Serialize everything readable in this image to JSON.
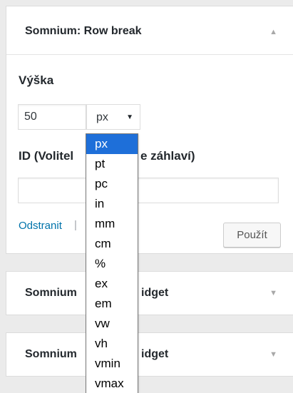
{
  "main_widget": {
    "title": "Somnium: Row break",
    "height_label": "Výška",
    "height_value": "50",
    "unit_selected": "px",
    "id_label_left": "ID (Volitel",
    "id_label_right": "e záhlaví)",
    "title_value": "",
    "remove_label": "Odstranit",
    "separator": "|",
    "apply_label": "Použít",
    "toggle_icon": "triangle-up-icon"
  },
  "collapsed_widgets": [
    {
      "title_left": "Somnium",
      "title_right": "idget",
      "toggle_icon": "triangle-down-icon"
    },
    {
      "title_left": "Somnium",
      "title_right": "idget",
      "toggle_icon": "triangle-down-icon"
    }
  ],
  "unit_dropdown": {
    "options": [
      "px",
      "pt",
      "pc",
      "in",
      "mm",
      "cm",
      "%",
      "ex",
      "em",
      "vw",
      "vh",
      "vmin",
      "vmax"
    ],
    "selected": "px",
    "highlight_color": "#1e6fd9"
  },
  "colors": {
    "link": "#0073aa",
    "background": "#ebebeb",
    "panel": "#ffffff"
  }
}
